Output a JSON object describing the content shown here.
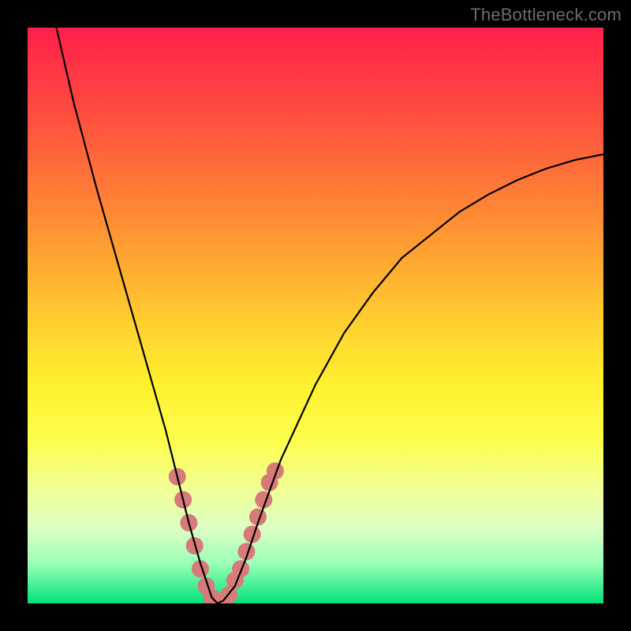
{
  "watermark": "TheBottleneck.com",
  "chart_data": {
    "type": "line",
    "title": "",
    "xlabel": "",
    "ylabel": "",
    "xlim": [
      0,
      100
    ],
    "ylim": [
      0,
      100
    ],
    "grid": false,
    "legend": false,
    "series": [
      {
        "name": "bottleneck-curve",
        "color": "#000000",
        "x": [
          5,
          8,
          12,
          16,
          20,
          22,
          24,
          26,
          28,
          30,
          31,
          32,
          33,
          34,
          36,
          38,
          40,
          44,
          50,
          55,
          60,
          65,
          70,
          75,
          80,
          85,
          90,
          95,
          100
        ],
        "y": [
          100,
          87,
          72,
          58,
          44,
          37,
          30,
          22,
          14,
          7,
          4,
          1,
          0,
          0.5,
          3,
          8,
          14,
          25,
          38,
          47,
          54,
          60,
          64,
          68,
          71,
          73.5,
          75.5,
          77,
          78
        ]
      }
    ],
    "markers": [
      {
        "name": "highlight-dots",
        "color": "#d77a7a",
        "radius": 11,
        "points": [
          {
            "x": 26,
            "y": 22
          },
          {
            "x": 27,
            "y": 18
          },
          {
            "x": 28,
            "y": 14
          },
          {
            "x": 29,
            "y": 10
          },
          {
            "x": 30,
            "y": 6
          },
          {
            "x": 31,
            "y": 3
          },
          {
            "x": 32,
            "y": 1
          },
          {
            "x": 33,
            "y": 0
          },
          {
            "x": 34,
            "y": 0.5
          },
          {
            "x": 35,
            "y": 1.5
          },
          {
            "x": 36,
            "y": 4
          },
          {
            "x": 37,
            "y": 6
          },
          {
            "x": 38,
            "y": 9
          },
          {
            "x": 39,
            "y": 12
          },
          {
            "x": 40,
            "y": 15
          },
          {
            "x": 41,
            "y": 18
          },
          {
            "x": 42,
            "y": 21
          },
          {
            "x": 43,
            "y": 23
          }
        ]
      }
    ]
  }
}
